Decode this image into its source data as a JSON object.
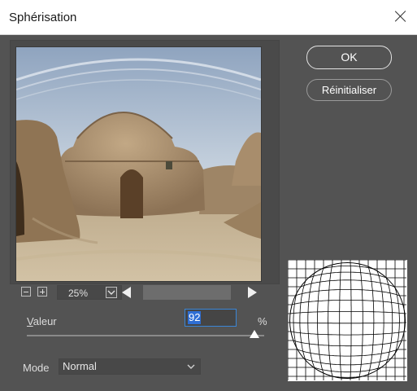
{
  "window": {
    "title": "Sphérisation"
  },
  "buttons": {
    "ok": "OK",
    "reset": "Réinitialiser"
  },
  "zoom": {
    "value": "25%"
  },
  "controls": {
    "valeur_first": "V",
    "valeur_rest": "aleur",
    "value": "92",
    "percent_sign": "%",
    "mode_label": "Mode",
    "mode_value": "Normal",
    "slider_fraction": 0.96
  },
  "icons": {
    "close": "close-icon",
    "zoom_out": "minus-square-icon",
    "zoom_in": "plus-square-icon",
    "dropdown": "chevron-down-icon",
    "scroll_left": "triangle-left-icon",
    "scroll_right": "triangle-right-icon"
  },
  "colors": {
    "dialog_bg": "#535353",
    "selection": "#2f6ed3",
    "focus_border": "#3b86d6"
  }
}
